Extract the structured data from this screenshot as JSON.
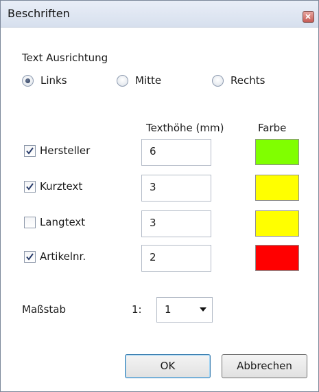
{
  "window": {
    "title": "Beschriften"
  },
  "alignment": {
    "label": "Text Ausrichtung",
    "options": [
      {
        "label": "Links",
        "selected": true
      },
      {
        "label": "Mitte",
        "selected": false
      },
      {
        "label": "Rechts",
        "selected": false
      }
    ]
  },
  "columns": {
    "height": "Texthöhe (mm)",
    "color": "Farbe"
  },
  "rows": [
    {
      "label": "Hersteller",
      "checked": true,
      "height": "6",
      "color": "#80ff00"
    },
    {
      "label": "Kurztext",
      "checked": true,
      "height": "3",
      "color": "#ffff00"
    },
    {
      "label": "Langtext",
      "checked": false,
      "height": "3",
      "color": "#ffff00"
    },
    {
      "label": "Artikelnr.",
      "checked": true,
      "height": "2",
      "color": "#ff0000"
    }
  ],
  "scale": {
    "label": "Maßstab",
    "prefix": "1:",
    "value": "1"
  },
  "buttons": {
    "ok": "OK",
    "cancel": "Abbrechen"
  }
}
